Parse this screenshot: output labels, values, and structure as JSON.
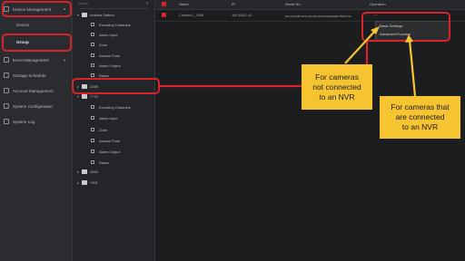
{
  "sidebar": {
    "items": [
      {
        "label": "Device Management",
        "icon": "device-icon"
      },
      {
        "label": "Device",
        "icon": ""
      },
      {
        "label": "Group",
        "icon": ""
      },
      {
        "label": "Event Management",
        "icon": "event-icon"
      },
      {
        "label": "Storage Schedule",
        "icon": "storage-icon"
      },
      {
        "label": "Account Management",
        "icon": "account-icon"
      },
      {
        "label": "System Configuration",
        "icon": "config-icon"
      },
      {
        "label": "System Log",
        "icon": "log-icon"
      }
    ]
  },
  "tree": {
    "search_placeholder": "Search",
    "nodes": [
      {
        "label": "Indiana Station",
        "type": "folder"
      },
      {
        "label": "Encoding Channels",
        "type": "leaf"
      },
      {
        "label": "Alarm Input",
        "type": "leaf"
      },
      {
        "label": "Zone",
        "type": "leaf"
      },
      {
        "label": "Access Point",
        "type": "leaf"
      },
      {
        "label": "Alarm Output",
        "type": "leaf"
      },
      {
        "label": "Radar",
        "type": "leaf"
      },
      {
        "label": "2255",
        "type": "folder"
      },
      {
        "label": "7770",
        "type": "folder"
      },
      {
        "label": "Encoding Channels",
        "type": "leaf"
      },
      {
        "label": "Alarm Input",
        "type": "leaf"
      },
      {
        "label": "Zone",
        "type": "leaf"
      },
      {
        "label": "Access Point",
        "type": "leaf"
      },
      {
        "label": "Alarm Output",
        "type": "leaf"
      },
      {
        "label": "Radar",
        "type": "leaf"
      },
      {
        "label": "2664",
        "type": "folder"
      },
      {
        "label": "7901",
        "type": "folder"
      }
    ]
  },
  "table": {
    "headers": [
      "Name",
      "IP",
      "Serial No.",
      "Operation"
    ],
    "rows": [
      {
        "name": "Camera 1_2255",
        "ip": "192.168.1.41",
        "serial": "DS-2CD2387G2P-LSU/SL20190123AAWRF7894F743"
      }
    ]
  },
  "popup": {
    "items": [
      "Basic Settings",
      "Advanced Function"
    ]
  },
  "callouts": {
    "left": [
      "For cameras",
      "not connected",
      "to an NVR"
    ],
    "right": [
      "For cameras that",
      "are connected",
      "to an NVR"
    ]
  },
  "colors": {
    "highlight": "#d8232a",
    "callout": "#f6c431"
  }
}
